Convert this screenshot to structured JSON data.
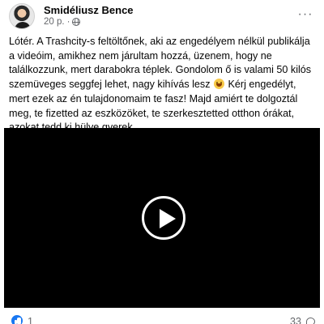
{
  "post": {
    "author": "Smidéliusz Bence",
    "time": "20 p.",
    "separator": "·",
    "more_label": "···",
    "text_before_emoji": "Lótér. A Trashcity-s feltöltőnek, aki az engedélyem nélkül publikálja a videóim, amikhez nem járultam hozzá, üzenem, hogy ne találkozzunk, mert darabokra téplek. Gondolom ő is valami 50 kilós szemüveges seggfej lehet, nagy kihívás lesz",
    "text_after_emoji": " Kérj engedélyt, mert ezek az én tulajdonomaim te fasz! Majd amiért te dolgoztál meg, te fizetted az eszközöket, te szerkesztetted otthon órákat, azokat tedd ki hülye gyerek.",
    "emoji_icon": "smiling-face-emoji",
    "privacy_icon": "globe-icon"
  },
  "video": {
    "background_color": "#000000",
    "play_icon": "play-icon"
  },
  "footer": {
    "reaction_icon": "like-icon",
    "reaction_count": "1",
    "comment_count": "33",
    "comment_icon": "comment-icon"
  },
  "colors": {
    "like_blue": "#1877f2",
    "secondary_text": "#65676b"
  }
}
